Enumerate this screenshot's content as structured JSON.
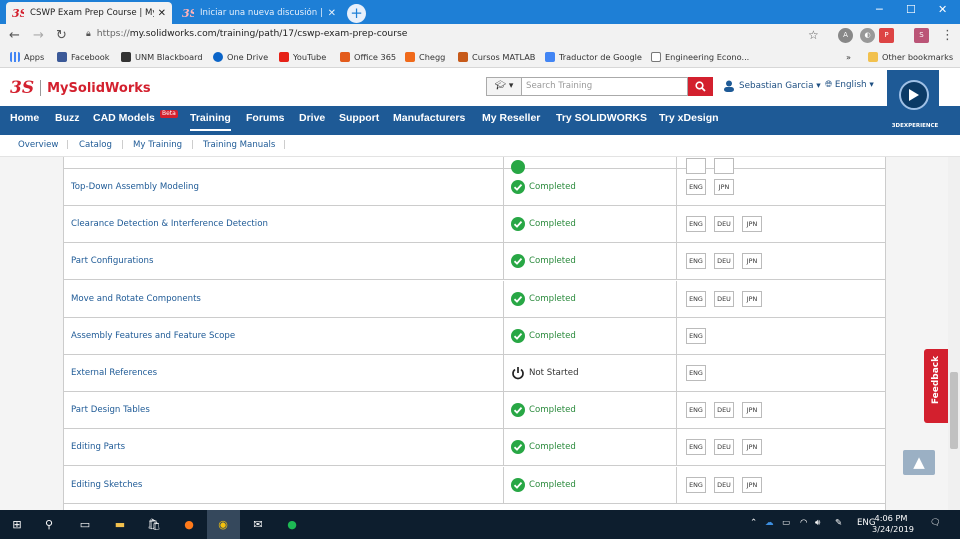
{
  "browser": {
    "tabs": [
      {
        "title": "CSWP Exam Prep Course | MySol",
        "active": true
      },
      {
        "title": "Iniciar una nueva discusión | SOL",
        "active": false
      }
    ],
    "new_tab_label": "+",
    "window": {
      "minimize": "─",
      "maximize": "☐",
      "close": "✕"
    },
    "url_protocol": "https://",
    "url_rest": "my.solidworks.com/training/path/17/cswp-exam-prep-course",
    "bookmarks": [
      {
        "label": "Apps",
        "color": "#d3202e"
      },
      {
        "label": "Facebook",
        "color": "#3b5998"
      },
      {
        "label": "UNM Blackboard",
        "color": "#333333"
      },
      {
        "label": "One Drive",
        "color": "#0a64c8"
      },
      {
        "label": "YouTube",
        "color": "#e62117"
      },
      {
        "label": "Office 365",
        "color": "#e35b1c"
      },
      {
        "label": "Chegg",
        "color": "#f06a1b"
      },
      {
        "label": "Cursos MATLAB",
        "color": "#c75a1a"
      },
      {
        "label": "Traductor de Google",
        "color": "#4285f4"
      },
      {
        "label": "Engineering Econo...",
        "color": "#777777"
      }
    ],
    "more_bookmarks": "»",
    "other_bookmarks": "Other bookmarks"
  },
  "site": {
    "brand": "MySolidWorks",
    "brand_color": "#d3202e",
    "search_placeholder": "Search Training",
    "user_name": "Sebastian Garcia ▾",
    "language": "English ▾",
    "nav": [
      {
        "label": "Home"
      },
      {
        "label": "Buzz"
      },
      {
        "label": "CAD Models"
      },
      {
        "label": "Training",
        "active": true
      },
      {
        "label": "Forums"
      },
      {
        "label": "Drive"
      },
      {
        "label": "Support"
      },
      {
        "label": "Manufacturers"
      },
      {
        "label": "My Reseller"
      },
      {
        "label": "Try SOLIDWORKS"
      },
      {
        "label": "Try xDesign"
      }
    ],
    "beta_badge": "Beta",
    "experience_label": "3DEXPERIENCE",
    "subnav": [
      "Overview",
      "Catalog",
      "My Training",
      "Training Manuals"
    ],
    "nav_color": "#1e5a96"
  },
  "course_rows": [
    {
      "name": "Top-Down Assembly Modeling",
      "status": "Completed",
      "langs": [
        "ENG",
        "JPN"
      ]
    },
    {
      "name": "Clearance Detection & Interference Detection",
      "status": "Completed",
      "langs": [
        "ENG",
        "DEU",
        "JPN"
      ]
    },
    {
      "name": "Part Configurations",
      "status": "Completed",
      "langs": [
        "ENG",
        "DEU",
        "JPN"
      ]
    },
    {
      "name": "Move and Rotate Components",
      "status": "Completed",
      "langs": [
        "ENG",
        "DEU",
        "JPN"
      ]
    },
    {
      "name": "Assembly Features and Feature Scope",
      "status": "Completed",
      "langs": [
        "ENG"
      ]
    },
    {
      "name": "External References",
      "status": "Not Started",
      "langs": [
        "ENG"
      ]
    },
    {
      "name": "Part Design Tables",
      "status": "Completed",
      "langs": [
        "ENG",
        "DEU",
        "JPN"
      ]
    },
    {
      "name": "Editing Parts",
      "status": "Completed",
      "langs": [
        "ENG",
        "DEU",
        "JPN"
      ]
    },
    {
      "name": "Editing Sketches",
      "status": "Completed",
      "langs": [
        "ENG",
        "DEU",
        "JPN"
      ]
    }
  ],
  "feedback_label": "Feedback",
  "taskbar": {
    "language": "ENG",
    "time": "4:06 PM",
    "date": "3/24/2019"
  }
}
